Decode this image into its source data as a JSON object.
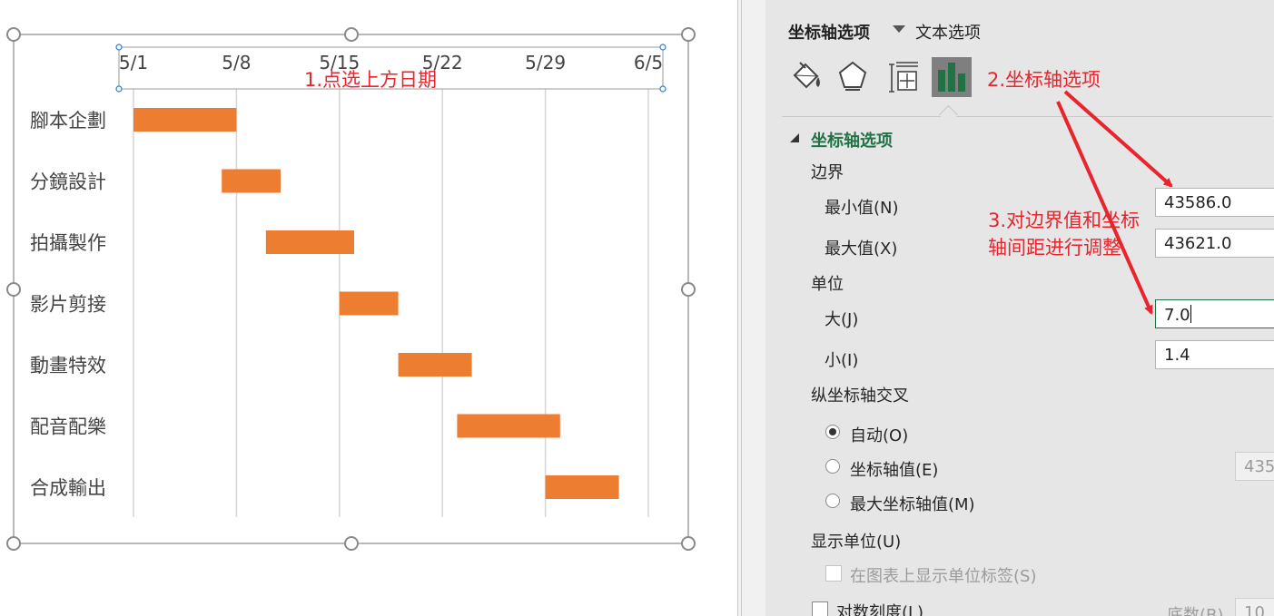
{
  "chart_data": {
    "type": "bar",
    "subtype": "gantt",
    "categories": [
      "腳本企劃",
      "分鏡設計",
      "拍攝製作",
      "影片剪接",
      "動畫特效",
      "配音配樂",
      "合成輸出"
    ],
    "series": [
      {
        "start": [
          "5/1",
          "5/8.5",
          "5/11.5",
          "5/16.5",
          "5/20.5",
          "5/24.5",
          "5/30.5"
        ],
        "end": [
          "5/8",
          "5/12.5",
          "5/17.5",
          "5/20.5",
          "5/25.5",
          "5/31.5",
          "6/4.5"
        ]
      }
    ],
    "x_tick_labels": [
      "5/1",
      "5/8",
      "5/15",
      "5/22",
      "5/29",
      "6/5"
    ],
    "x_min": 43586,
    "x_max": 43621,
    "x_major_unit": 7,
    "bar_start_day": [
      0,
      6,
      9,
      14,
      18,
      22,
      28
    ],
    "bar_duration_days": [
      7,
      4,
      6,
      4,
      5,
      7,
      5
    ],
    "bar_color": "#ed7d31",
    "grid": true,
    "axis_position": "top"
  },
  "annotations": {
    "step1": "1.点选上方日期",
    "step2": "2.坐标轴选项",
    "step3_line1": "3.对边界值和坐标",
    "step3_line2": "轴间距进行调整",
    "color": "#e8242c"
  },
  "panel": {
    "tab_axis_options": "坐标轴选项",
    "tab_text_options": "文本选项",
    "icons": [
      "fill-line-icon",
      "effects-pentagon-icon",
      "size-properties-icon",
      "axis-options-bar-chart-icon"
    ],
    "section_title": "坐标轴选项",
    "bounds_label": "边界",
    "min_label": "最小值(N)",
    "min_value": "43586.0",
    "max_label": "最大值(X)",
    "max_value": "43621.0",
    "units_label": "单位",
    "major_label": "大(J)",
    "major_value": "7.0",
    "minor_label": "小(I)",
    "minor_value": "1.4",
    "cross_label": "纵坐标轴交叉",
    "radio_auto": "自动(O)",
    "radio_axis_value": "坐标轴值(E)",
    "axis_value_field": "435",
    "radio_max_axis": "最大坐标轴值(M)",
    "display_units_label": "显示单位(U)",
    "show_units_label": "在图表上显示单位标签(S)",
    "log_scale_label": "对数刻度(L)",
    "base_label": "底数(B)",
    "base_value": "10",
    "accent_color": "#217346"
  }
}
